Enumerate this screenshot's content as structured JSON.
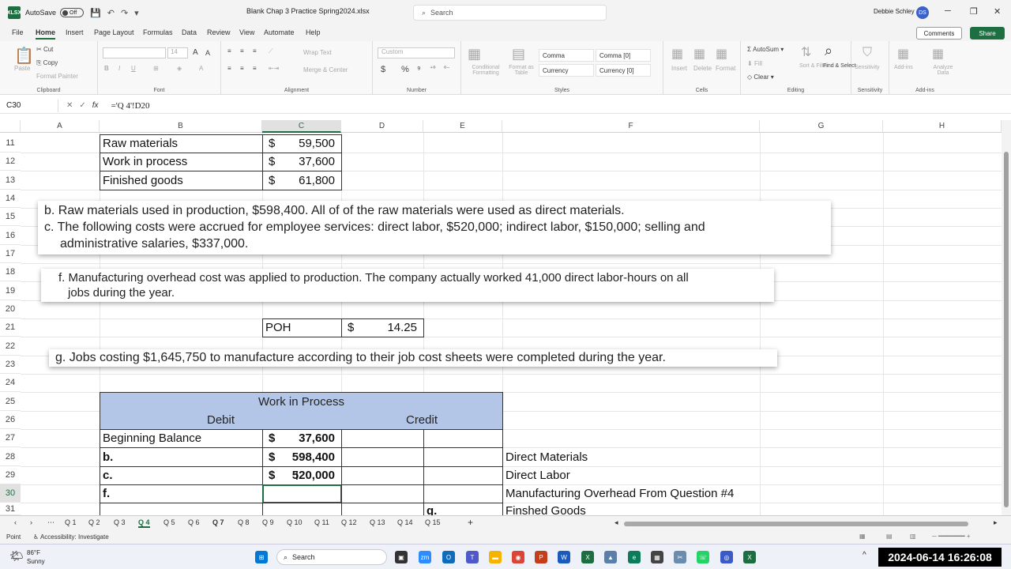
{
  "titlebar": {
    "app_logo": "XLSX",
    "autosave_label": "AutoSave",
    "autosave_state": "Off",
    "doc_title": "Blank Chap 3 Practice Spring2024.xlsx",
    "search_placeholder": "Search",
    "user_name": "Debbie Schley",
    "user_initials": "DS"
  },
  "menu": {
    "items": [
      "File",
      "Home",
      "Insert",
      "Page Layout",
      "Formulas",
      "Data",
      "Review",
      "View",
      "Automate",
      "Help"
    ],
    "comments": "Comments",
    "share": "Share"
  },
  "ribbon": {
    "clipboard": {
      "paste": "Paste",
      "cut": "Cut",
      "copy": "Copy",
      "format_painter": "Format Painter",
      "label": "Clipboard"
    },
    "font": {
      "size": "14",
      "label": "Font"
    },
    "alignment": {
      "wrap": "Wrap Text",
      "merge": "Merge & Center",
      "label": "Alignment"
    },
    "number": {
      "format": "Custom",
      "label": "Number"
    },
    "styles": {
      "conditional": "Conditional Formatting",
      "format_table": "Format as Table",
      "cells": [
        "Comma",
        "Comma [0]",
        "Currency",
        "Currency [0]"
      ],
      "label": "Styles"
    },
    "cells": {
      "insert": "Insert",
      "delete": "Delete",
      "format": "Format",
      "label": "Cells"
    },
    "editing": {
      "autosum": "AutoSum",
      "fill": "Fill",
      "clear": "Clear",
      "sort": "Sort & Filter",
      "find": "Find & Select",
      "label": "Editing"
    },
    "sensitivity": {
      "btn": "Sensitivity",
      "label": "Sensitivity"
    },
    "addins": {
      "btn": "Add-ins",
      "analyze": "Analyze Data",
      "label": "Add-ins"
    }
  },
  "formula_bar": {
    "name_box": "C30",
    "formula": "='Q 4'!D20"
  },
  "columns": [
    "A",
    "B",
    "C",
    "D",
    "E",
    "F",
    "G",
    "H"
  ],
  "rows": [
    "11",
    "12",
    "13",
    "14",
    "15",
    "16",
    "17",
    "18",
    "19",
    "20",
    "21",
    "22",
    "23",
    "24",
    "25",
    "26",
    "27",
    "28",
    "29",
    "30",
    "31"
  ],
  "cells": {
    "raw_materials": {
      "label": "Raw materials",
      "cur": "$",
      "val": "59,500"
    },
    "work_in_process": {
      "label": "Work in process",
      "cur": "$",
      "val": "37,600"
    },
    "finished_goods": {
      "label": "Finished goods",
      "cur": "$",
      "val": "61,800"
    },
    "poh": {
      "label": "POH",
      "cur": "$",
      "val": "14.25"
    }
  },
  "notes": {
    "b": "b. Raw materials used in production, $598,400. All of of the raw materials were used as direct materials.",
    "c1": "c. The following costs were accrued for employee services: direct labor, $520,000; indirect labor, $150,000; selling and",
    "c2": "administrative salaries, $337,000.",
    "f1": "f. Manufacturing overhead cost was applied to production. The company actually worked 41,000 direct labor-hours on all",
    "f2": "jobs during the year.",
    "g": "g. Jobs costing $1,645,750 to manufacture according to their job cost sheets were completed during the year."
  },
  "wip": {
    "title": "Work in Process",
    "debit": "Debit",
    "credit": "Credit",
    "rows": [
      {
        "label": "Beginning Balance",
        "cur": "$",
        "val": "37,600",
        "desc": ""
      },
      {
        "label": "b.",
        "cur": "$",
        "val": "598,400",
        "desc": "Direct Materials"
      },
      {
        "label": "c.",
        "cur": "$",
        "val": "520,000",
        "desc": "Direct Labor"
      },
      {
        "label": "f.",
        "cur": "",
        "val": "",
        "desc": "Manufacturing Overhead From Question #4"
      },
      {
        "label": "",
        "cur": "",
        "val": "",
        "desc": "Finshed Goods",
        "credit_label": "g."
      }
    ]
  },
  "sheet_tabs": [
    "Q 1",
    "Q 2",
    "Q 3",
    "Q 4",
    "Q 5",
    "Q 6",
    "Q 7",
    "Q 8",
    "Q 9",
    "Q 10",
    "Q 11",
    "Q 12",
    "Q 13",
    "Q 14",
    "Q 15"
  ],
  "active_tab": "Q 4",
  "statusbar": {
    "mode": "Point",
    "accessibility": "Accessibility: Investigate"
  },
  "taskbar": {
    "weather_temp": "86°F",
    "weather_desc": "Sunny",
    "search": "Search",
    "clock": "2024-06-14 16:26:08"
  },
  "colors": {
    "excel_green": "#1d6f42",
    "wip_header": "#b4c6e7"
  }
}
